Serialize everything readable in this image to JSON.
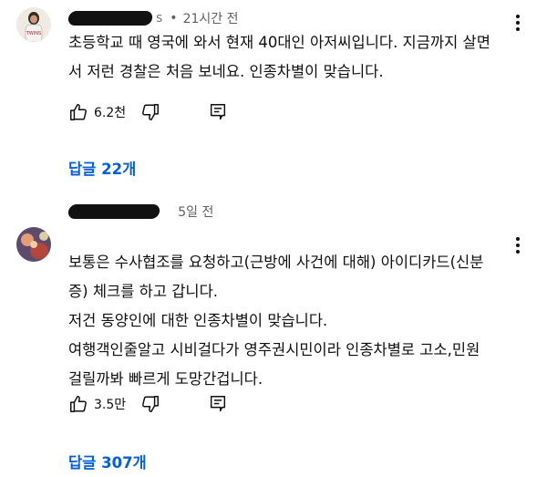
{
  "comments": [
    {
      "author_suffix": "s",
      "separator": "•",
      "time": "21시간 전",
      "text": "초등학교 때 영국에 와서 현재 40대인 아저씨입니다. 지금까지 살면\n서 저런 경찰은 처음 보네요. 인종차별이 맞습니다.",
      "likes": "6.2천",
      "replies": "답글 22개",
      "like_icon": "thumbs-up-icon",
      "dislike_icon": "thumbs-down-icon",
      "reply_icon": "reply-comment-icon"
    },
    {
      "time": "5일 전",
      "lines": [
        "보통은 수사협조를 요청하고(근방에 사건에 대해) 아이디카드(신분\n증) 체크를 하고 갑니다.",
        "저건 동양인에 대한 인종차별이 맞습니다.",
        "여행객인줄알고 시비걸다가 영주권시민이라 인종차별로 고소,민원\n걸릴까봐 빠르게 도망간겁니다."
      ],
      "likes": "3.5만",
      "replies": "답글 307개",
      "like_icon": "thumbs-up-icon",
      "dislike_icon": "thumbs-down-icon",
      "reply_icon": "reply-comment-icon"
    }
  ],
  "colors": {
    "link": "#065fd4",
    "meta": "#606060",
    "text": "#0f0f0f"
  }
}
